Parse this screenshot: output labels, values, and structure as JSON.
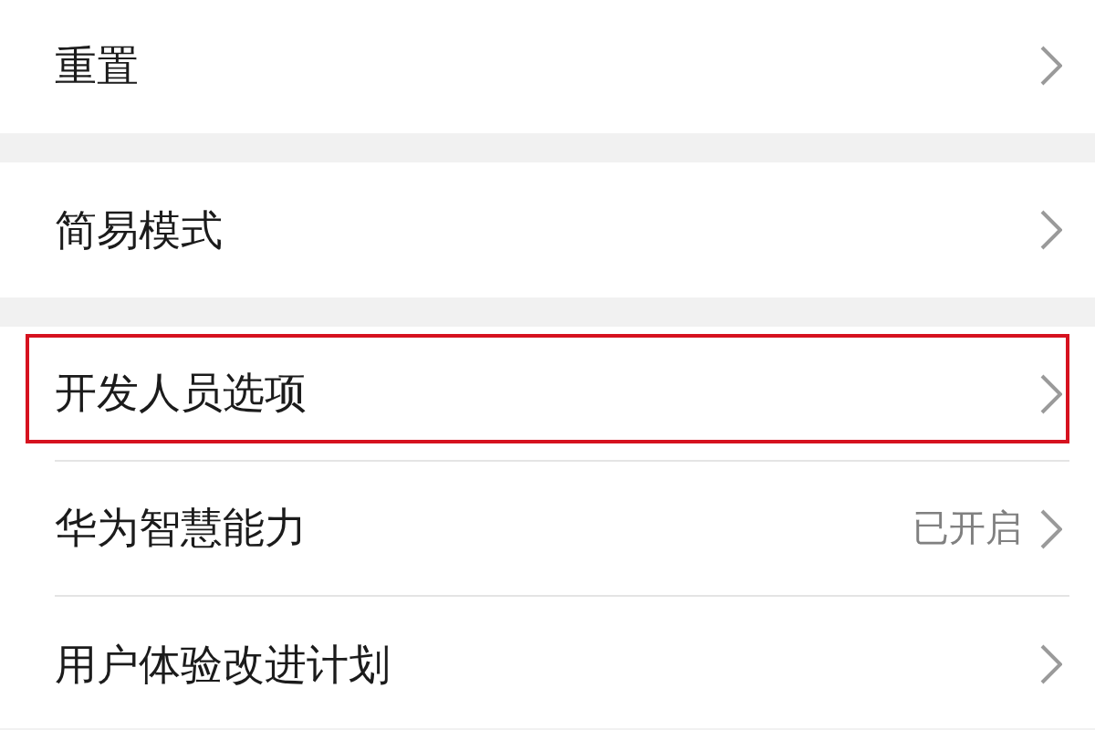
{
  "groups": [
    {
      "items": [
        {
          "label": "重置",
          "highlighted": false
        }
      ]
    },
    {
      "items": [
        {
          "label": "简易模式",
          "highlighted": false
        }
      ]
    },
    {
      "items": [
        {
          "label": "开发人员选项",
          "highlighted": true
        },
        {
          "label": "华为智慧能力",
          "value": "已开启",
          "highlighted": false
        },
        {
          "label": "用户体验改进计划",
          "highlighted": false
        }
      ]
    }
  ]
}
